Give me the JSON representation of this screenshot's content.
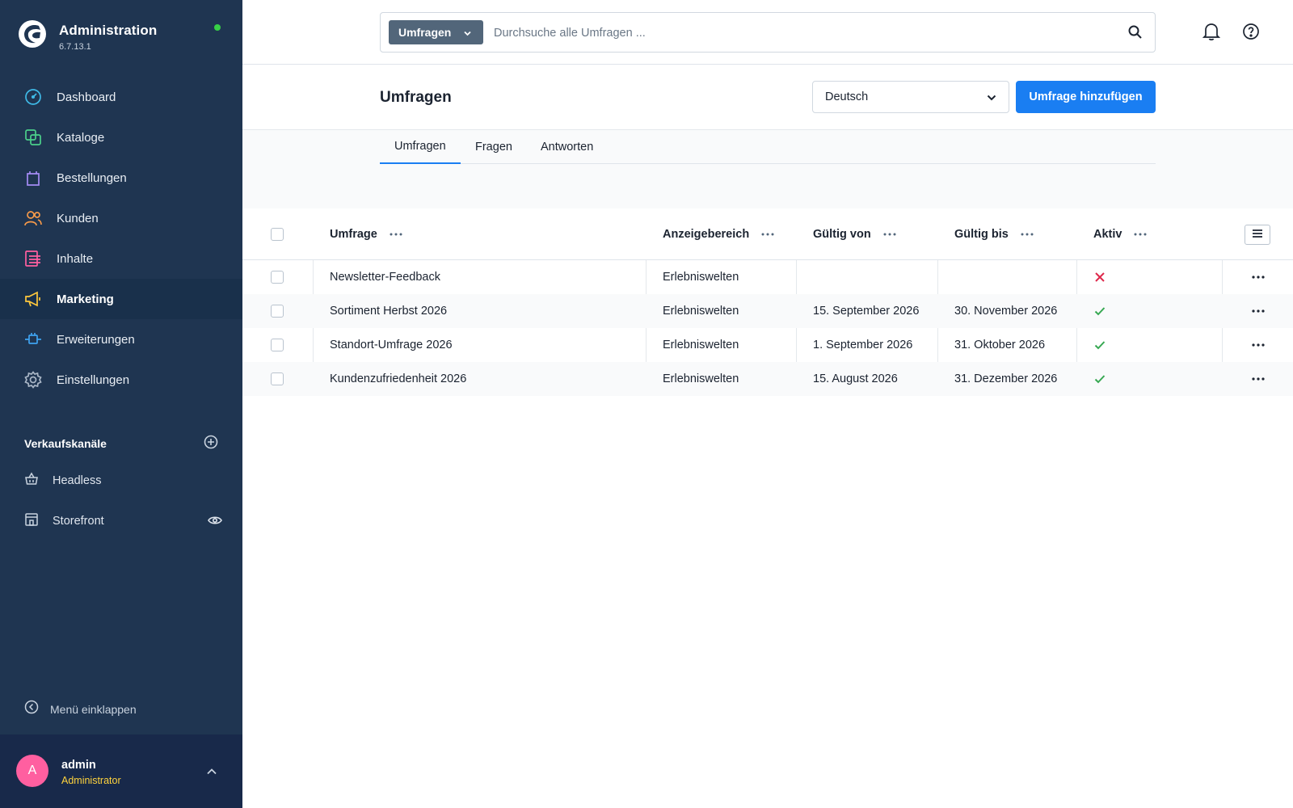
{
  "app": {
    "title": "Administration",
    "version": "6.7.13.1"
  },
  "sidebar": {
    "items": [
      {
        "label": "Dashboard",
        "icon": "dashboard-icon"
      },
      {
        "label": "Kataloge",
        "icon": "catalog-icon"
      },
      {
        "label": "Bestellungen",
        "icon": "shopping-bag-icon"
      },
      {
        "label": "Kunden",
        "icon": "customers-icon"
      },
      {
        "label": "Inhalte",
        "icon": "content-icon"
      },
      {
        "label": "Marketing",
        "icon": "megaphone-icon",
        "active": true
      },
      {
        "label": "Erweiterungen",
        "icon": "plug-icon"
      },
      {
        "label": "Einstellungen",
        "icon": "gear-icon"
      }
    ],
    "sales_channels_title": "Verkaufskanäle",
    "sales_channels": [
      {
        "label": "Headless",
        "icon": "basket-icon"
      },
      {
        "label": "Storefront",
        "icon": "storefront-icon"
      }
    ],
    "collapse_label": "Menü einklappen"
  },
  "user": {
    "initial": "A",
    "name": "admin",
    "role": "Administrator"
  },
  "search": {
    "scope": "Umfragen",
    "placeholder": "Durchsuche alle Umfragen ..."
  },
  "page": {
    "title": "Umfragen",
    "language": "Deutsch",
    "add_button": "Umfrage hinzufügen"
  },
  "tabs": [
    {
      "label": "Umfragen",
      "active": true
    },
    {
      "label": "Fragen"
    },
    {
      "label": "Antworten"
    }
  ],
  "table": {
    "columns": [
      "Umfrage",
      "Anzeigebereich",
      "Gültig von",
      "Gültig bis",
      "Aktiv"
    ],
    "rows": [
      {
        "name": "Newsletter-Feedback",
        "area": "Erlebniswelten",
        "valid_from": "",
        "valid_to": "",
        "active": false
      },
      {
        "name": "Sortiment Herbst 2026",
        "area": "Erlebniswelten",
        "valid_from": "15. September 2026",
        "valid_to": "30. November 2026",
        "active": true
      },
      {
        "name": "Standort-Umfrage 2026",
        "area": "Erlebniswelten",
        "valid_from": "1. September 2026",
        "valid_to": "31. Oktober 2026",
        "active": true
      },
      {
        "name": "Kundenzufriedenheit 2026",
        "area": "Erlebniswelten",
        "valid_from": "15. August 2026",
        "valid_to": "31. Dezember 2026",
        "active": true
      }
    ]
  },
  "colors": {
    "sidebar_bg": "#1f3551",
    "accent": "#1a7ef2",
    "active_true": "#37a852",
    "active_false": "#de294c"
  }
}
